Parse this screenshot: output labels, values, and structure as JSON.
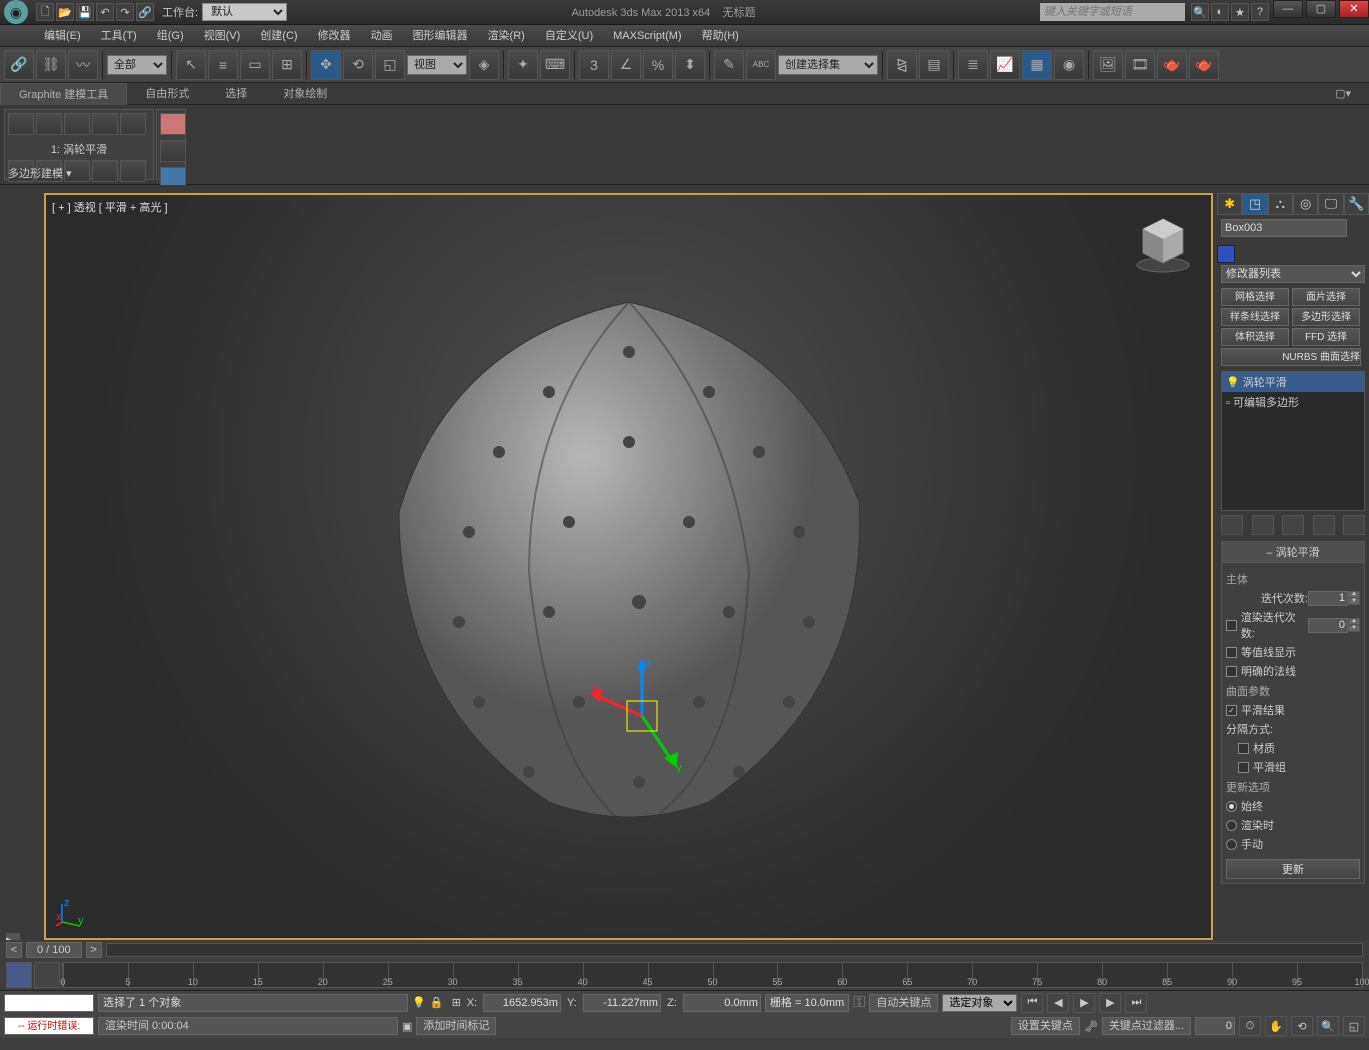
{
  "title": {
    "app": "Autodesk 3ds Max  2013 x64",
    "doc": "无标题"
  },
  "workspace": {
    "label": "工作台:",
    "value": "默认"
  },
  "search": {
    "placeholder": "键入关键字或短语"
  },
  "menu": [
    "编辑(E)",
    "工具(T)",
    "组(G)",
    "视图(V)",
    "创建(C)",
    "修改器",
    "动画",
    "图形编辑器",
    "渲染(R)",
    "自定义(U)",
    "MAXScript(M)",
    "帮助(H)"
  ],
  "toolbar": {
    "filter": "全部",
    "view": "视图",
    "selset": "创建选择集"
  },
  "ribbon": {
    "tabs": [
      "Graphite 建模工具",
      "自由形式",
      "选择",
      "对象绘制"
    ],
    "mod_label": "1: 涡轮平滑",
    "poly_label": "多边形建模 ▾"
  },
  "viewport": {
    "label": "[ + ] 透视 [ 平滑 + 高光 ]"
  },
  "cmd": {
    "object_name": "Box003",
    "modifier_list": "修改器列表",
    "sel_buttons": [
      "网格选择",
      "面片选择",
      "样条线选择",
      "多边形选择",
      "体积选择",
      "FFD 选择"
    ],
    "nurbs": "NURBS 曲面选择",
    "stack": [
      "涡轮平滑",
      "可编辑多边形"
    ],
    "rollout_title": "涡轮平滑",
    "main_group": "主体",
    "iterations_label": "迭代次数:",
    "iterations": "1",
    "render_iter_label": "渲染迭代次数:",
    "render_iter": "0",
    "isoline": "等值线显示",
    "explicit": "明确的法线",
    "surface_group": "曲面参数",
    "smooth_result": "平滑结果",
    "separate_by": "分隔方式:",
    "by_material": "材质",
    "by_smoothing": "平滑组",
    "update_group": "更新选项",
    "always": "始终",
    "on_render": "渲染时",
    "manual": "手动",
    "update_btn": "更新"
  },
  "timeline": {
    "frame": "0 / 100",
    "ticks": [
      0,
      5,
      10,
      15,
      20,
      25,
      30,
      35,
      40,
      45,
      50,
      55,
      60,
      65,
      70,
      75,
      80,
      85,
      90,
      95,
      100
    ]
  },
  "status": {
    "selected": "选择了 1 个对象",
    "x": "1652.953m",
    "y": "-11.227mm",
    "z": "0.0mm",
    "grid": "栅格 = 10.0mm",
    "autokey": "自动关键点",
    "key_select": "选定对象",
    "setkey": "设置关键点",
    "keyfilter": "关键点过滤器...",
    "runtime_err": "-- 运行时错误:",
    "render_time": "渲染时间  0:00:04",
    "add_time": "添加时间标记"
  }
}
